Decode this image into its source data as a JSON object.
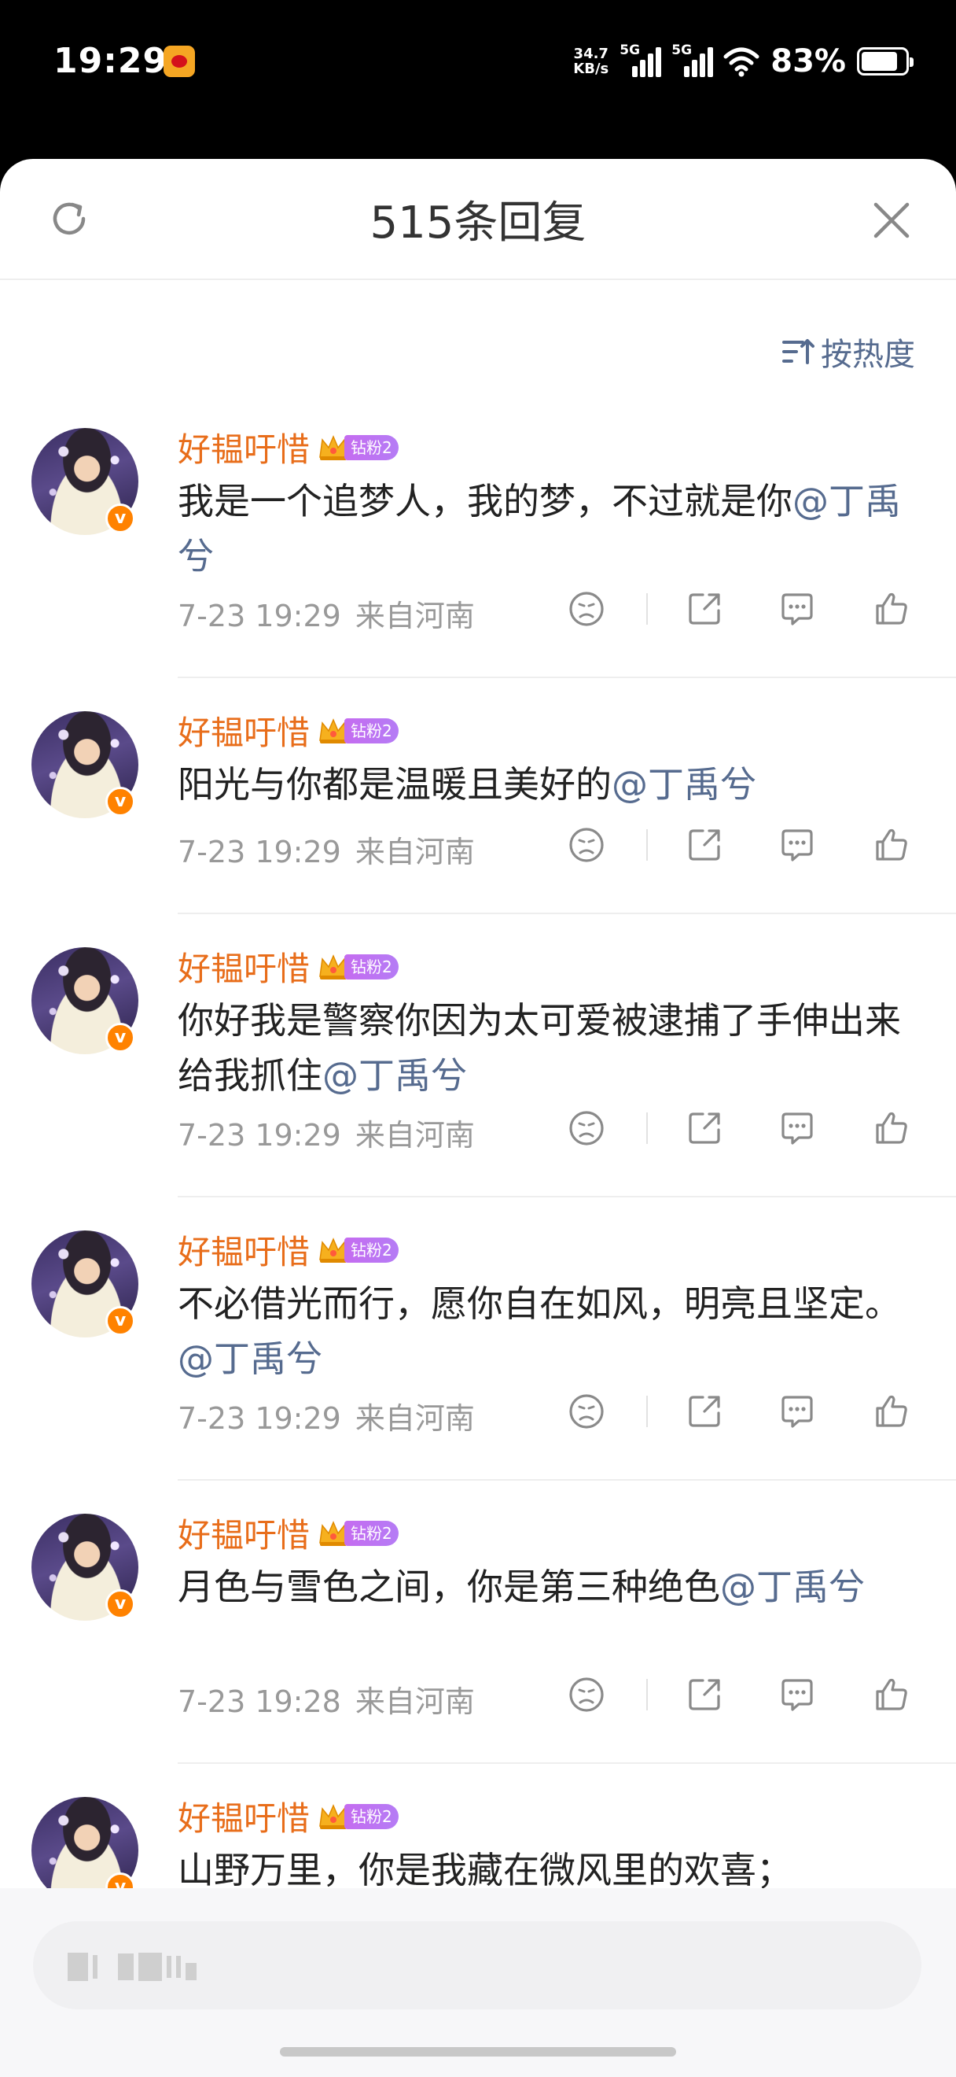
{
  "status_bar": {
    "time": "19:29",
    "app_icon": "weibo-notification-icon",
    "speed_value": "34.7",
    "speed_unit": "KB/s",
    "signal1_label": "5G",
    "signal2_label": "5G",
    "battery_percent": "83%",
    "battery_level": 0.83
  },
  "header": {
    "title": "515条回复",
    "refresh_icon": "refresh-icon",
    "close_icon": "close-icon"
  },
  "sort": {
    "label": "按热度",
    "icon": "sort-icon"
  },
  "comments": [
    {
      "username": "好韫吁惜",
      "fan_badge": "钻粉2",
      "text": "我是一个追梦人，我的梦，不过就是你",
      "mention": "@丁禹兮",
      "time": "7-23 19:29",
      "location": "来自河南"
    },
    {
      "username": "好韫吁惜",
      "fan_badge": "钻粉2",
      "text": "阳光与你都是温暖且美好的",
      "mention": "@丁禹兮",
      "time": "7-23 19:29",
      "location": "来自河南"
    },
    {
      "username": "好韫吁惜",
      "fan_badge": "钻粉2",
      "text": "你好我是警察你因为太可爱被逮捕了手伸出来给我抓住",
      "mention": "@丁禹兮",
      "time": "7-23 19:29",
      "location": "来自河南"
    },
    {
      "username": "好韫吁惜",
      "fan_badge": "钻粉2",
      "text": "不必借光而行，愿你自在如风，明亮且坚定。",
      "mention": "@丁禹兮",
      "time": "7-23 19:29",
      "location": "来自河南"
    },
    {
      "username": "好韫吁惜",
      "fan_badge": "钻粉2",
      "text": "月色与雪色之间，你是第三种绝色",
      "mention": "@丁禹兮",
      "time": "7-23 19:28",
      "location": "来自河南"
    },
    {
      "username": "好韫吁惜",
      "fan_badge": "钻粉2",
      "text": "山野万里，你是我藏在微风里的欢喜；",
      "mention": "",
      "time": "",
      "location": ""
    }
  ],
  "colors": {
    "username": "#e86d1a",
    "mention": "#566b8f",
    "meta": "#999999",
    "verified_badge": "#ff8200",
    "fan_badge": "#c56cf0"
  }
}
